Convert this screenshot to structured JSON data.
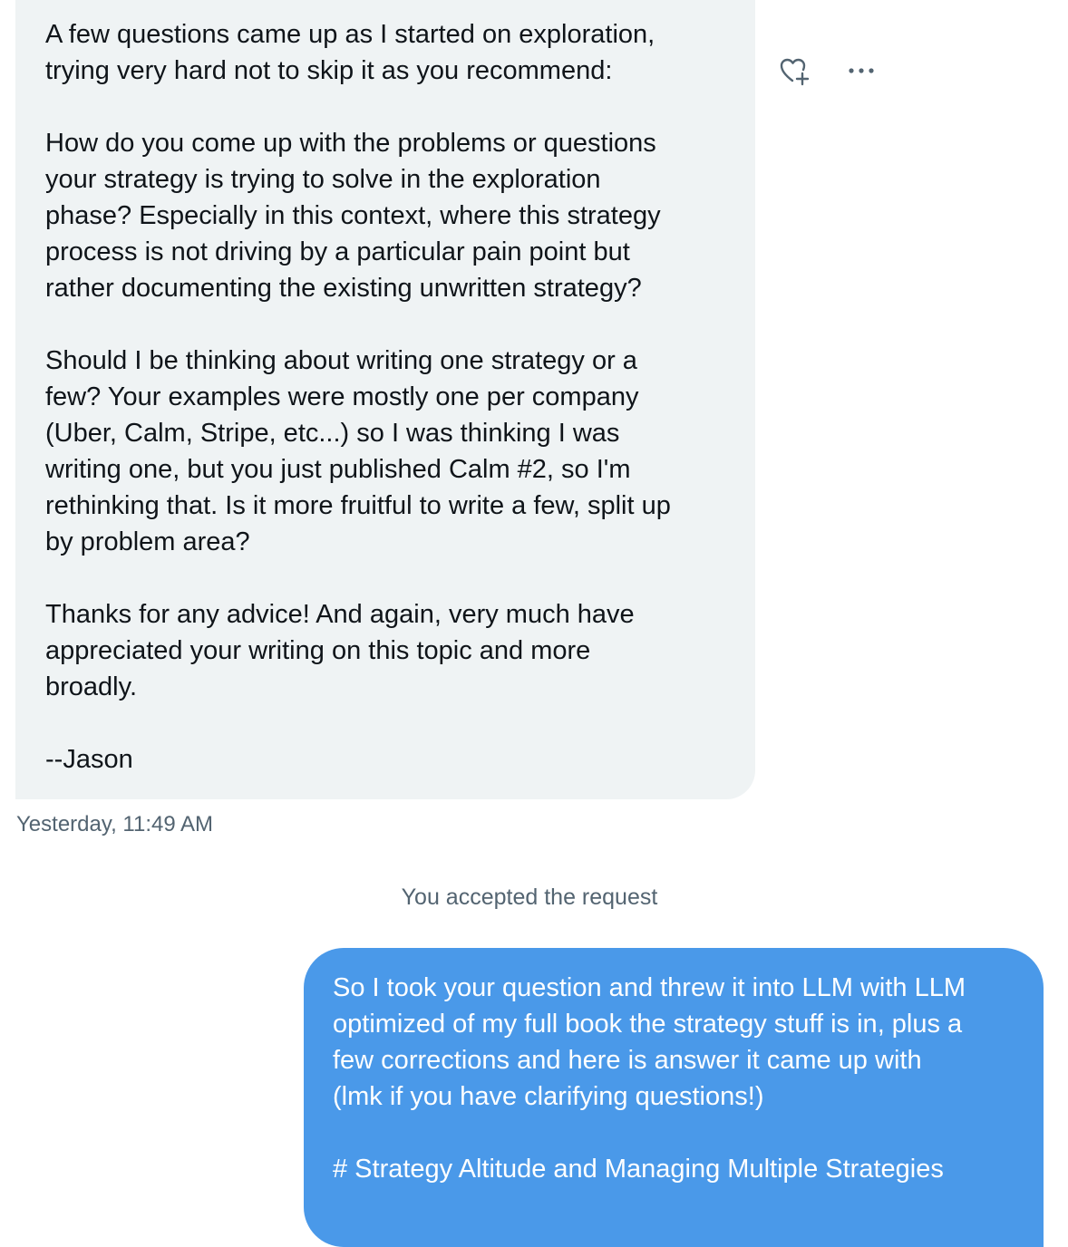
{
  "incoming_message": {
    "paragraphs": [
      "A few questions came up as I started on exploration,\ntrying very hard not to skip it as you recommend:",
      "How do you come up with the problems or questions\nyour strategy is trying to solve in the exploration\nphase? Especially in this context, where this strategy\nprocess is not driving by a particular pain point but\nrather documenting the existing unwritten strategy?",
      "Should I be thinking about writing one strategy or a\nfew? Your examples were mostly one per company\n(Uber, Calm, Stripe, etc...) so I was thinking I was\nwriting one, but you just published Calm #2, so I'm\nrethinking that. Is it more fruitful to write a few, split up\nby problem area?",
      "Thanks for any advice! And again, very much have\nappreciated your writing on this topic and more\nbroadly.",
      "--Jason"
    ],
    "timestamp": "Yesterday, 11:49 AM"
  },
  "actions": {
    "react_icon": "heart-plus-icon",
    "more_icon": "more-horizontal-icon"
  },
  "system_note": "You accepted the request",
  "outgoing_message": {
    "paragraphs": [
      "So I took your question and threw it into LLM with LLM\noptimized of my full book the strategy stuff is in, plus a\nfew corrections and here is answer it came up with\n(lmk if you have clarifying questions!)",
      "# Strategy Altitude and Managing Multiple Strategies"
    ]
  },
  "colors": {
    "incoming_bubble": "#eff3f4",
    "outgoing_bubble": "#4a99e9",
    "secondary_text": "#536471",
    "icon": "#536471"
  }
}
